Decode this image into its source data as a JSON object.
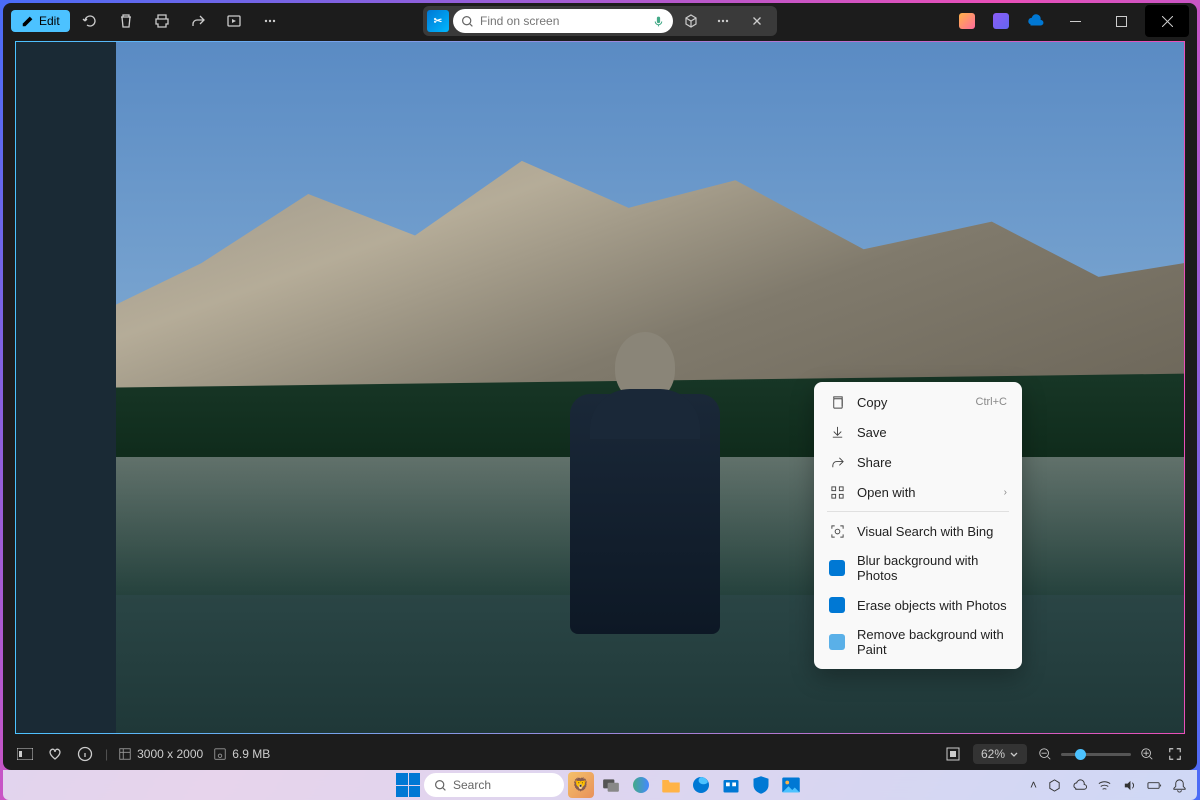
{
  "toolbar": {
    "edit_label": "Edit"
  },
  "search": {
    "placeholder": "Find on screen"
  },
  "context_menu": {
    "items": [
      {
        "icon": "copy",
        "label": "Copy",
        "shortcut": "Ctrl+C"
      },
      {
        "icon": "save",
        "label": "Save"
      },
      {
        "icon": "share",
        "label": "Share"
      },
      {
        "icon": "openwith",
        "label": "Open with",
        "submenu": true
      },
      {
        "sep": true
      },
      {
        "icon": "visualsearch",
        "label": "Visual Search with Bing"
      },
      {
        "icon": "photos",
        "label": "Blur background with Photos",
        "color": "#0078d4"
      },
      {
        "icon": "photos",
        "label": "Erase objects with Photos",
        "color": "#0078d4"
      },
      {
        "icon": "paint",
        "label": "Remove background with Paint",
        "color": "#5ab0e8"
      }
    ]
  },
  "statusbar": {
    "dimensions": "3000 x 2000",
    "filesize": "6.9 MB",
    "zoom": "62%"
  },
  "taskbar": {
    "search_placeholder": "Search"
  }
}
